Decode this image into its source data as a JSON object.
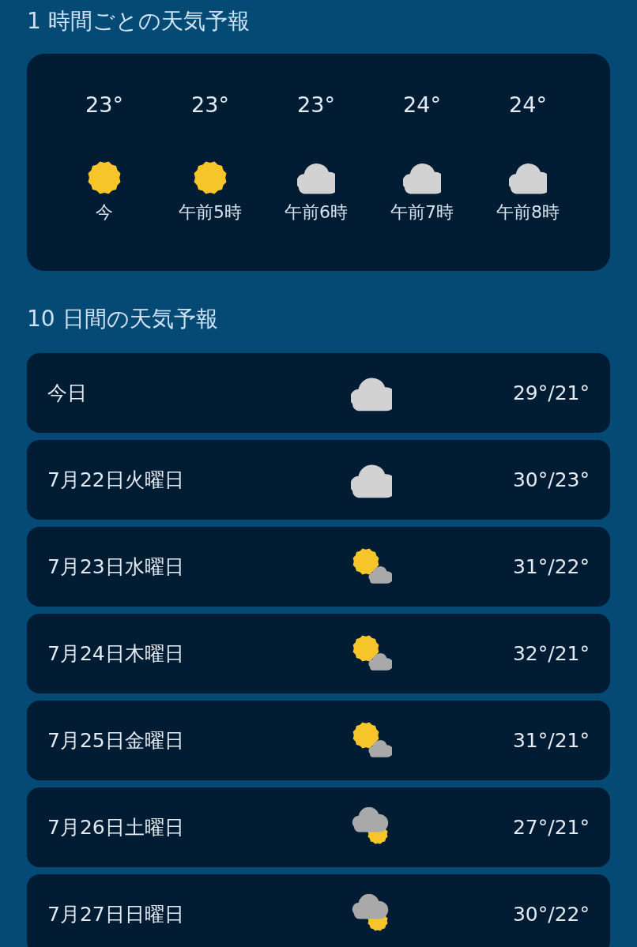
{
  "hourly": {
    "title": "1 時間ごとの天気予報",
    "items": [
      {
        "temp": "23°",
        "kind": "sunny",
        "time": "今"
      },
      {
        "temp": "23°",
        "kind": "sunny",
        "time": "午前5時"
      },
      {
        "temp": "23°",
        "kind": "cloudy",
        "time": "午前6時"
      },
      {
        "temp": "24°",
        "kind": "cloudy",
        "time": "午前7時"
      },
      {
        "temp": "24°",
        "kind": "cloudy",
        "time": "午前8時"
      }
    ]
  },
  "daily": {
    "title": "10 日間の天気予報",
    "days": [
      {
        "day": "今日",
        "kind": "cloudy",
        "temps": "29°/21°"
      },
      {
        "day": "7月22日火曜日",
        "kind": "cloudy",
        "temps": "30°/23°"
      },
      {
        "day": "7月23日水曜日",
        "kind": "sun_cloud",
        "temps": "31°/22°"
      },
      {
        "day": "7月24日木曜日",
        "kind": "sun_cloud",
        "temps": "32°/21°"
      },
      {
        "day": "7月25日金曜日",
        "kind": "sun_cloud",
        "temps": "31°/21°"
      },
      {
        "day": "7月26日土曜日",
        "kind": "cloud_sun",
        "temps": "27°/21°"
      },
      {
        "day": "7月27日日曜日",
        "kind": "cloud_sun",
        "temps": "30°/22°"
      }
    ]
  }
}
